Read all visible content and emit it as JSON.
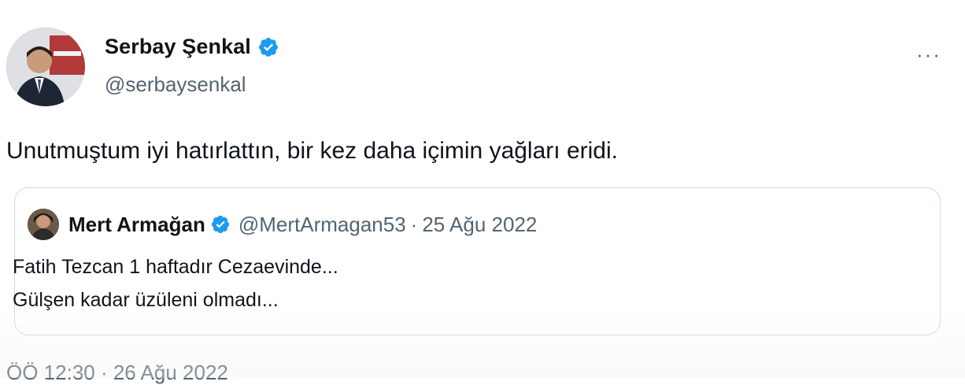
{
  "author": {
    "name": "Serbay Şenkal",
    "handle": "@serbaysenkal"
  },
  "tweet_text": "Unutmuştum iyi hatırlattın, bir kez daha içimin yağları eridi.",
  "quoted": {
    "name": "Mert Armağan",
    "handle": "@MertArmagan53",
    "separator": "·",
    "date": "25 Ağu 2022",
    "line1": "Fatih Tezcan 1 haftadır Cezaevinde...",
    "line2": "Gülşen kadar üzüleni olmadı..."
  },
  "timestamp": "ÖÖ 12:30 · 26 Ağu 2022",
  "more_label": "···",
  "colors": {
    "verified_blue": "#1d9bf0",
    "secondary_text": "#536471",
    "border": "#cfd9de"
  }
}
